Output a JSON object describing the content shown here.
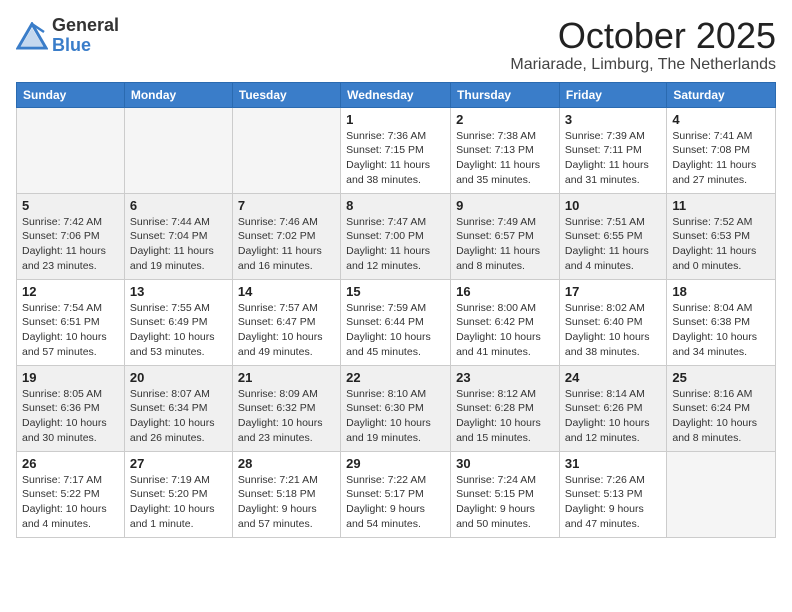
{
  "logo": {
    "general": "General",
    "blue": "Blue"
  },
  "header": {
    "month": "October 2025",
    "location": "Mariarade, Limburg, The Netherlands"
  },
  "weekdays": [
    "Sunday",
    "Monday",
    "Tuesday",
    "Wednesday",
    "Thursday",
    "Friday",
    "Saturday"
  ],
  "weeks": [
    [
      {
        "day": "",
        "empty": true
      },
      {
        "day": "",
        "empty": true
      },
      {
        "day": "",
        "empty": true
      },
      {
        "day": "1",
        "sunrise": "7:36 AM",
        "sunset": "7:15 PM",
        "daylight": "11 hours and 38 minutes."
      },
      {
        "day": "2",
        "sunrise": "7:38 AM",
        "sunset": "7:13 PM",
        "daylight": "11 hours and 35 minutes."
      },
      {
        "day": "3",
        "sunrise": "7:39 AM",
        "sunset": "7:11 PM",
        "daylight": "11 hours and 31 minutes."
      },
      {
        "day": "4",
        "sunrise": "7:41 AM",
        "sunset": "7:08 PM",
        "daylight": "11 hours and 27 minutes."
      }
    ],
    [
      {
        "day": "5",
        "sunrise": "7:42 AM",
        "sunset": "7:06 PM",
        "daylight": "11 hours and 23 minutes."
      },
      {
        "day": "6",
        "sunrise": "7:44 AM",
        "sunset": "7:04 PM",
        "daylight": "11 hours and 19 minutes."
      },
      {
        "day": "7",
        "sunrise": "7:46 AM",
        "sunset": "7:02 PM",
        "daylight": "11 hours and 16 minutes."
      },
      {
        "day": "8",
        "sunrise": "7:47 AM",
        "sunset": "7:00 PM",
        "daylight": "11 hours and 12 minutes."
      },
      {
        "day": "9",
        "sunrise": "7:49 AM",
        "sunset": "6:57 PM",
        "daylight": "11 hours and 8 minutes."
      },
      {
        "day": "10",
        "sunrise": "7:51 AM",
        "sunset": "6:55 PM",
        "daylight": "11 hours and 4 minutes."
      },
      {
        "day": "11",
        "sunrise": "7:52 AM",
        "sunset": "6:53 PM",
        "daylight": "11 hours and 0 minutes."
      }
    ],
    [
      {
        "day": "12",
        "sunrise": "7:54 AM",
        "sunset": "6:51 PM",
        "daylight": "10 hours and 57 minutes."
      },
      {
        "day": "13",
        "sunrise": "7:55 AM",
        "sunset": "6:49 PM",
        "daylight": "10 hours and 53 minutes."
      },
      {
        "day": "14",
        "sunrise": "7:57 AM",
        "sunset": "6:47 PM",
        "daylight": "10 hours and 49 minutes."
      },
      {
        "day": "15",
        "sunrise": "7:59 AM",
        "sunset": "6:44 PM",
        "daylight": "10 hours and 45 minutes."
      },
      {
        "day": "16",
        "sunrise": "8:00 AM",
        "sunset": "6:42 PM",
        "daylight": "10 hours and 41 minutes."
      },
      {
        "day": "17",
        "sunrise": "8:02 AM",
        "sunset": "6:40 PM",
        "daylight": "10 hours and 38 minutes."
      },
      {
        "day": "18",
        "sunrise": "8:04 AM",
        "sunset": "6:38 PM",
        "daylight": "10 hours and 34 minutes."
      }
    ],
    [
      {
        "day": "19",
        "sunrise": "8:05 AM",
        "sunset": "6:36 PM",
        "daylight": "10 hours and 30 minutes."
      },
      {
        "day": "20",
        "sunrise": "8:07 AM",
        "sunset": "6:34 PM",
        "daylight": "10 hours and 26 minutes."
      },
      {
        "day": "21",
        "sunrise": "8:09 AM",
        "sunset": "6:32 PM",
        "daylight": "10 hours and 23 minutes."
      },
      {
        "day": "22",
        "sunrise": "8:10 AM",
        "sunset": "6:30 PM",
        "daylight": "10 hours and 19 minutes."
      },
      {
        "day": "23",
        "sunrise": "8:12 AM",
        "sunset": "6:28 PM",
        "daylight": "10 hours and 15 minutes."
      },
      {
        "day": "24",
        "sunrise": "8:14 AM",
        "sunset": "6:26 PM",
        "daylight": "10 hours and 12 minutes."
      },
      {
        "day": "25",
        "sunrise": "8:16 AM",
        "sunset": "6:24 PM",
        "daylight": "10 hours and 8 minutes."
      }
    ],
    [
      {
        "day": "26",
        "sunrise": "7:17 AM",
        "sunset": "5:22 PM",
        "daylight": "10 hours and 4 minutes."
      },
      {
        "day": "27",
        "sunrise": "7:19 AM",
        "sunset": "5:20 PM",
        "daylight": "10 hours and 1 minute."
      },
      {
        "day": "28",
        "sunrise": "7:21 AM",
        "sunset": "5:18 PM",
        "daylight": "9 hours and 57 minutes."
      },
      {
        "day": "29",
        "sunrise": "7:22 AM",
        "sunset": "5:17 PM",
        "daylight": "9 hours and 54 minutes."
      },
      {
        "day": "30",
        "sunrise": "7:24 AM",
        "sunset": "5:15 PM",
        "daylight": "9 hours and 50 minutes."
      },
      {
        "day": "31",
        "sunrise": "7:26 AM",
        "sunset": "5:13 PM",
        "daylight": "9 hours and 47 minutes."
      },
      {
        "day": "",
        "empty": true
      }
    ]
  ]
}
